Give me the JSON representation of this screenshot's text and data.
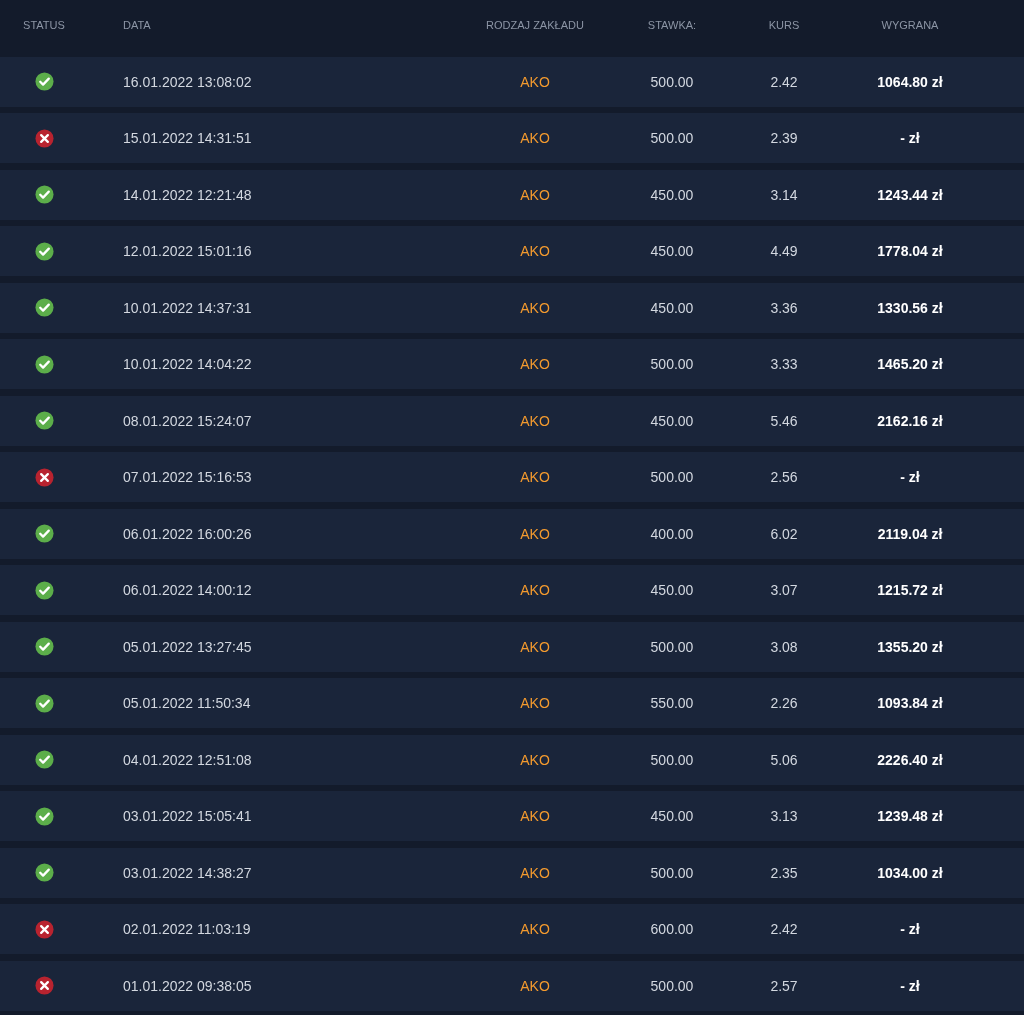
{
  "table": {
    "columns": [
      "STATUS",
      "DATA",
      "RODZAJ ZAKŁADU",
      "STAWKA:",
      "KURS",
      "WYGRANA"
    ],
    "rows": [
      {
        "won": true,
        "date": "16.01.2022 13:08:02",
        "type": "AKO",
        "stake": "500.00",
        "odds": "2.42",
        "win": "1064.80 zł"
      },
      {
        "won": false,
        "date": "15.01.2022 14:31:51",
        "type": "AKO",
        "stake": "500.00",
        "odds": "2.39",
        "win": "- zł"
      },
      {
        "won": true,
        "date": "14.01.2022 12:21:48",
        "type": "AKO",
        "stake": "450.00",
        "odds": "3.14",
        "win": "1243.44 zł"
      },
      {
        "won": true,
        "date": "12.01.2022 15:01:16",
        "type": "AKO",
        "stake": "450.00",
        "odds": "4.49",
        "win": "1778.04 zł"
      },
      {
        "won": true,
        "date": "10.01.2022 14:37:31",
        "type": "AKO",
        "stake": "450.00",
        "odds": "3.36",
        "win": "1330.56 zł"
      },
      {
        "won": true,
        "date": "10.01.2022 14:04:22",
        "type": "AKO",
        "stake": "500.00",
        "odds": "3.33",
        "win": "1465.20 zł"
      },
      {
        "won": true,
        "date": "08.01.2022 15:24:07",
        "type": "AKO",
        "stake": "450.00",
        "odds": "5.46",
        "win": "2162.16 zł"
      },
      {
        "won": false,
        "date": "07.01.2022 15:16:53",
        "type": "AKO",
        "stake": "500.00",
        "odds": "2.56",
        "win": "- zł"
      },
      {
        "won": true,
        "date": "06.01.2022 16:00:26",
        "type": "AKO",
        "stake": "400.00",
        "odds": "6.02",
        "win": "2119.04 zł"
      },
      {
        "won": true,
        "date": "06.01.2022 14:00:12",
        "type": "AKO",
        "stake": "450.00",
        "odds": "3.07",
        "win": "1215.72 zł"
      },
      {
        "won": true,
        "date": "05.01.2022 13:27:45",
        "type": "AKO",
        "stake": "500.00",
        "odds": "3.08",
        "win": "1355.20 zł"
      },
      {
        "won": true,
        "date": "05.01.2022 11:50:34",
        "type": "AKO",
        "stake": "550.00",
        "odds": "2.26",
        "win": "1093.84 zł"
      },
      {
        "won": true,
        "date": "04.01.2022 12:51:08",
        "type": "AKO",
        "stake": "500.00",
        "odds": "5.06",
        "win": "2226.40 zł"
      },
      {
        "won": true,
        "date": "03.01.2022 15:05:41",
        "type": "AKO",
        "stake": "450.00",
        "odds": "3.13",
        "win": "1239.48 zł"
      },
      {
        "won": true,
        "date": "03.01.2022 14:38:27",
        "type": "AKO",
        "stake": "500.00",
        "odds": "2.35",
        "win": "1034.00 zł"
      },
      {
        "won": false,
        "date": "02.01.2022 11:03:19",
        "type": "AKO",
        "stake": "600.00",
        "odds": "2.42",
        "win": "- zł"
      },
      {
        "won": false,
        "date": "01.01.2022 09:38:05",
        "type": "AKO",
        "stake": "500.00",
        "odds": "2.57",
        "win": "- zł"
      }
    ]
  }
}
